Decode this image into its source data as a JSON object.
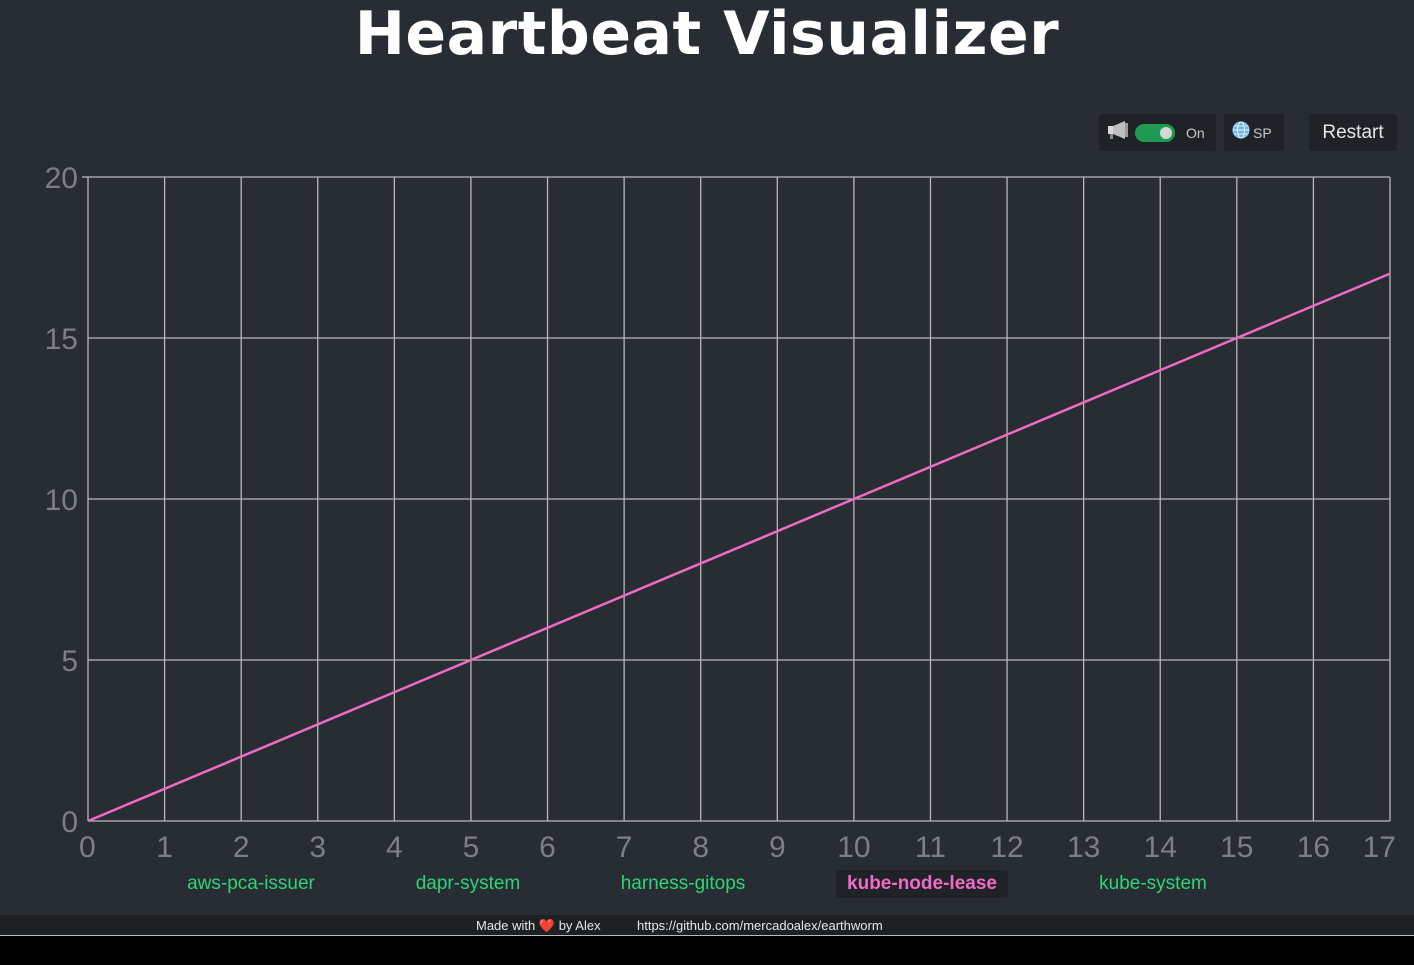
{
  "app": {
    "title": "Heartbeat Visualizer"
  },
  "controls": {
    "sound_icon": "megaphone-icon",
    "sound_toggle_state": "On",
    "lang_icon": "globe-icon",
    "lang_label": "SP",
    "restart_label": "Restart"
  },
  "tabs": [
    {
      "label": "aws-pca-issuer",
      "active": false
    },
    {
      "label": "dapr-system",
      "active": false
    },
    {
      "label": "harness-gitops",
      "active": false
    },
    {
      "label": "kube-node-lease",
      "active": true
    },
    {
      "label": "kube-system",
      "active": false
    }
  ],
  "footer": {
    "made_with": "Made with",
    "heart": "❤️",
    "by": "by Alex",
    "link": "https://github.com/mercadoalex/earthworm"
  },
  "colors": {
    "background": "#282c33",
    "line": "#f06bc5",
    "grid": "#b8b8b8",
    "tab_text": "#2ed47a"
  },
  "chart_data": {
    "type": "line",
    "xlim": [
      0,
      17
    ],
    "ylim": [
      0,
      20
    ],
    "x_ticks": [
      0,
      1,
      2,
      3,
      4,
      5,
      6,
      7,
      8,
      9,
      10,
      11,
      12,
      13,
      14,
      15,
      16,
      17
    ],
    "y_ticks": [
      0,
      5,
      10,
      15,
      20
    ],
    "grid": true,
    "series": [
      {
        "x": [
          0,
          17
        ],
        "y": [
          0,
          17
        ]
      }
    ]
  }
}
